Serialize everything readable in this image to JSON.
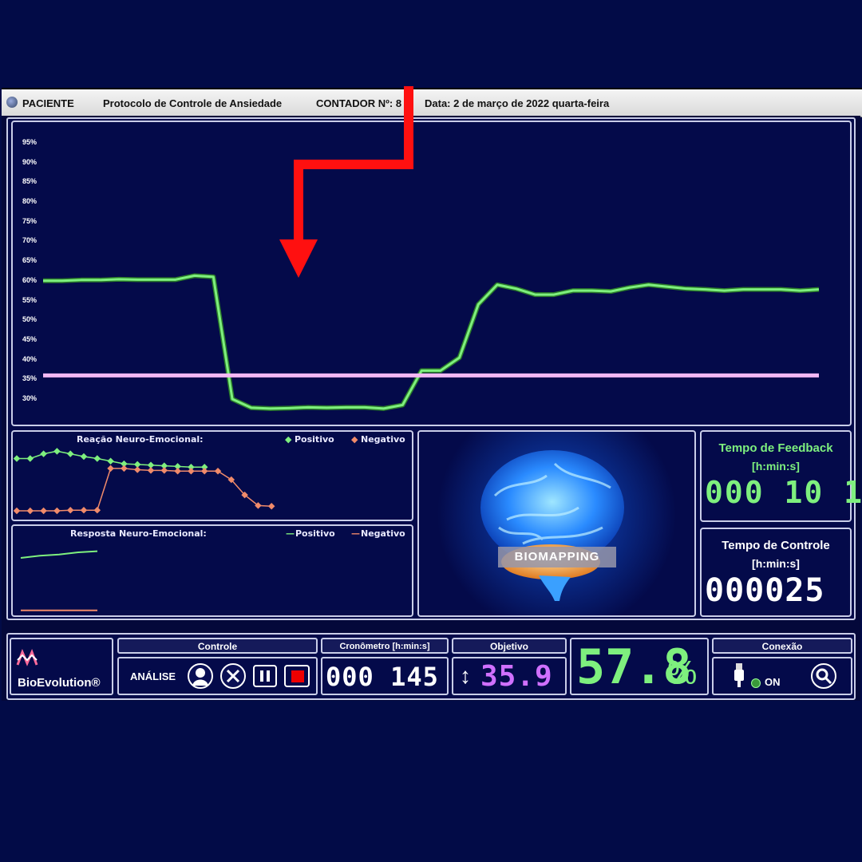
{
  "titlebar": {
    "title": "PACIENTE",
    "protocol": "Protocolo de Controle de Ansiedade",
    "contador": "CONTADOR Nº: 8",
    "date": "Data: 2 de março de 2022 quarta-feira"
  },
  "colors": {
    "background": "#020b47",
    "positivo": "#7ef07e",
    "negativo": "#f08a6a",
    "threshold": "#f4b8f4",
    "arrow": "#ff1010",
    "objetivo_digits": "#d070ff",
    "percent_digits": "#7ef07e"
  },
  "chart_data": [
    {
      "type": "line",
      "ylabel": "",
      "ylim": [
        25,
        97
      ],
      "y_ticks": [
        "95%",
        "90%",
        "85%",
        "80%",
        "75%",
        "70%",
        "65%",
        "60%",
        "55%",
        "50%",
        "45%",
        "40%",
        "35%",
        "30%"
      ],
      "series": [
        {
          "values": [
            60,
            60,
            60.2,
            60.2,
            60.4,
            60.3,
            60.3,
            60.3,
            61.3,
            61,
            30,
            27.8,
            27.6,
            27.7,
            27.9,
            27.8,
            27.9,
            27.9,
            27.6,
            28.5,
            37.2,
            37.2,
            40.5,
            54,
            59,
            58,
            56.5,
            56.5,
            57.5,
            57.5,
            57.3,
            58.3,
            59,
            58.5,
            58,
            57.8,
            57.5,
            57.8,
            57.8,
            57.8,
            57.5,
            57.8
          ]
        },
        {
          "values": [
            36,
            36
          ]
        }
      ],
      "grid": false
    },
    {
      "type": "line",
      "title": "Reação Neuro-Emocional:",
      "series": [
        {
          "name": "Positivo",
          "values": [
            8.5,
            8.5,
            9.2,
            9.6,
            9.2,
            8.8,
            8.5,
            8.1,
            7.7,
            7.6,
            7.5,
            7.4,
            7.3,
            7.2,
            7.2
          ]
        },
        {
          "name": "Negativo",
          "values": [
            0.6,
            0.6,
            0.6,
            0.6,
            0.7,
            0.7,
            0.7,
            7.0,
            7.0,
            6.8,
            6.7,
            6.7,
            6.6,
            6.6,
            6.6,
            6.6,
            5.3,
            3.0,
            1.4,
            1.3
          ]
        }
      ]
    },
    {
      "type": "line",
      "title": "Resposta Neuro-Emocional:",
      "series": [
        {
          "name": "Positivo",
          "values": [
            5.0,
            5.2,
            5.3,
            5.5,
            5.6
          ]
        },
        {
          "name": "Negativo",
          "values": [
            0.3,
            0.3,
            0.3,
            0.3,
            0.3
          ]
        }
      ]
    }
  ],
  "legend": {
    "positivo": "Positivo",
    "negativo": "Negativo"
  },
  "center": {
    "brain_label": "BIOMAPPING"
  },
  "feedback": {
    "title": "Tempo de Feedback",
    "unit": "[h:min:s]",
    "value": "000 10 1"
  },
  "controle_time": {
    "title": "Tempo de Controle",
    "unit": "[h:min:s]",
    "value": "000025"
  },
  "bottom": {
    "logo": "BioEvolution®",
    "controle_header": "Controle",
    "analise": "ANÁLISE",
    "cronometro_header": "Cronômetro [h:min:s]",
    "cronometro_value": "000 145",
    "objetivo_header": "Objetivo",
    "objetivo_value": "35.9",
    "percent_value": "57.8",
    "percent_symbol": "%",
    "conexao_header": "Conexão",
    "conexao_status": "ON"
  },
  "icons": [
    "user-icon",
    "tools-icon",
    "pause-icon",
    "stop-icon",
    "usb-icon",
    "search-icon",
    "updown-arrow-icon"
  ]
}
